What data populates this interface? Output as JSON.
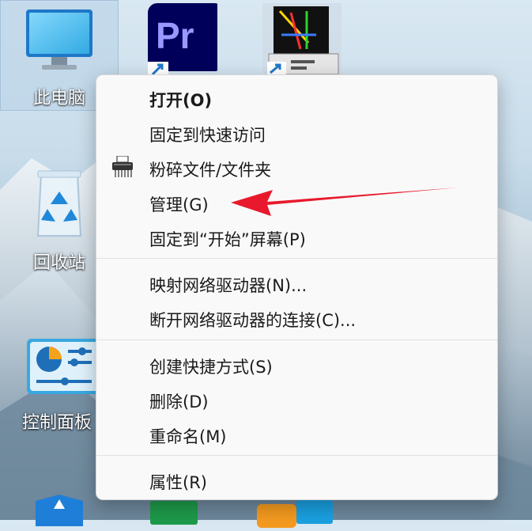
{
  "desktop": {
    "icons": [
      {
        "label": "此电脑",
        "icon": "computer-icon"
      },
      {
        "label": "",
        "icon": "premiere-pro-icon",
        "badge_text": "Pr"
      },
      {
        "label": "",
        "icon": "program-window-icon"
      },
      {
        "label": "回收站",
        "icon": "recycle-bin-icon"
      },
      {
        "label": "控制面板",
        "icon": "control-panel-icon"
      },
      {
        "label": "",
        "icon": "shield-icon"
      }
    ]
  },
  "context_menu": {
    "items": [
      {
        "label": "打开(O)",
        "bold": true
      },
      {
        "label": "固定到快速访问"
      },
      {
        "label": "粉碎文件/文件夹",
        "icon": "shredder-icon"
      },
      {
        "label": "管理(G)"
      },
      {
        "label": "固定到“开始”屏幕(P)"
      },
      {
        "label": "映射网络驱动器(N)..."
      },
      {
        "label": "断开网络驱动器的连接(C)..."
      },
      {
        "label": "创建快捷方式(S)"
      },
      {
        "label": "删除(D)"
      },
      {
        "label": "重命名(M)"
      },
      {
        "label": "属性(R)"
      }
    ]
  },
  "annotation": {
    "arrow_color": "#e8192c",
    "target": "管理(G)"
  },
  "colors": {
    "menu_bg": "#f9f9f9",
    "menu_text": "#1a1a1a",
    "selection": "#bed6e8",
    "pr_bg": "#00005b",
    "pr_text": "#9999ff"
  }
}
